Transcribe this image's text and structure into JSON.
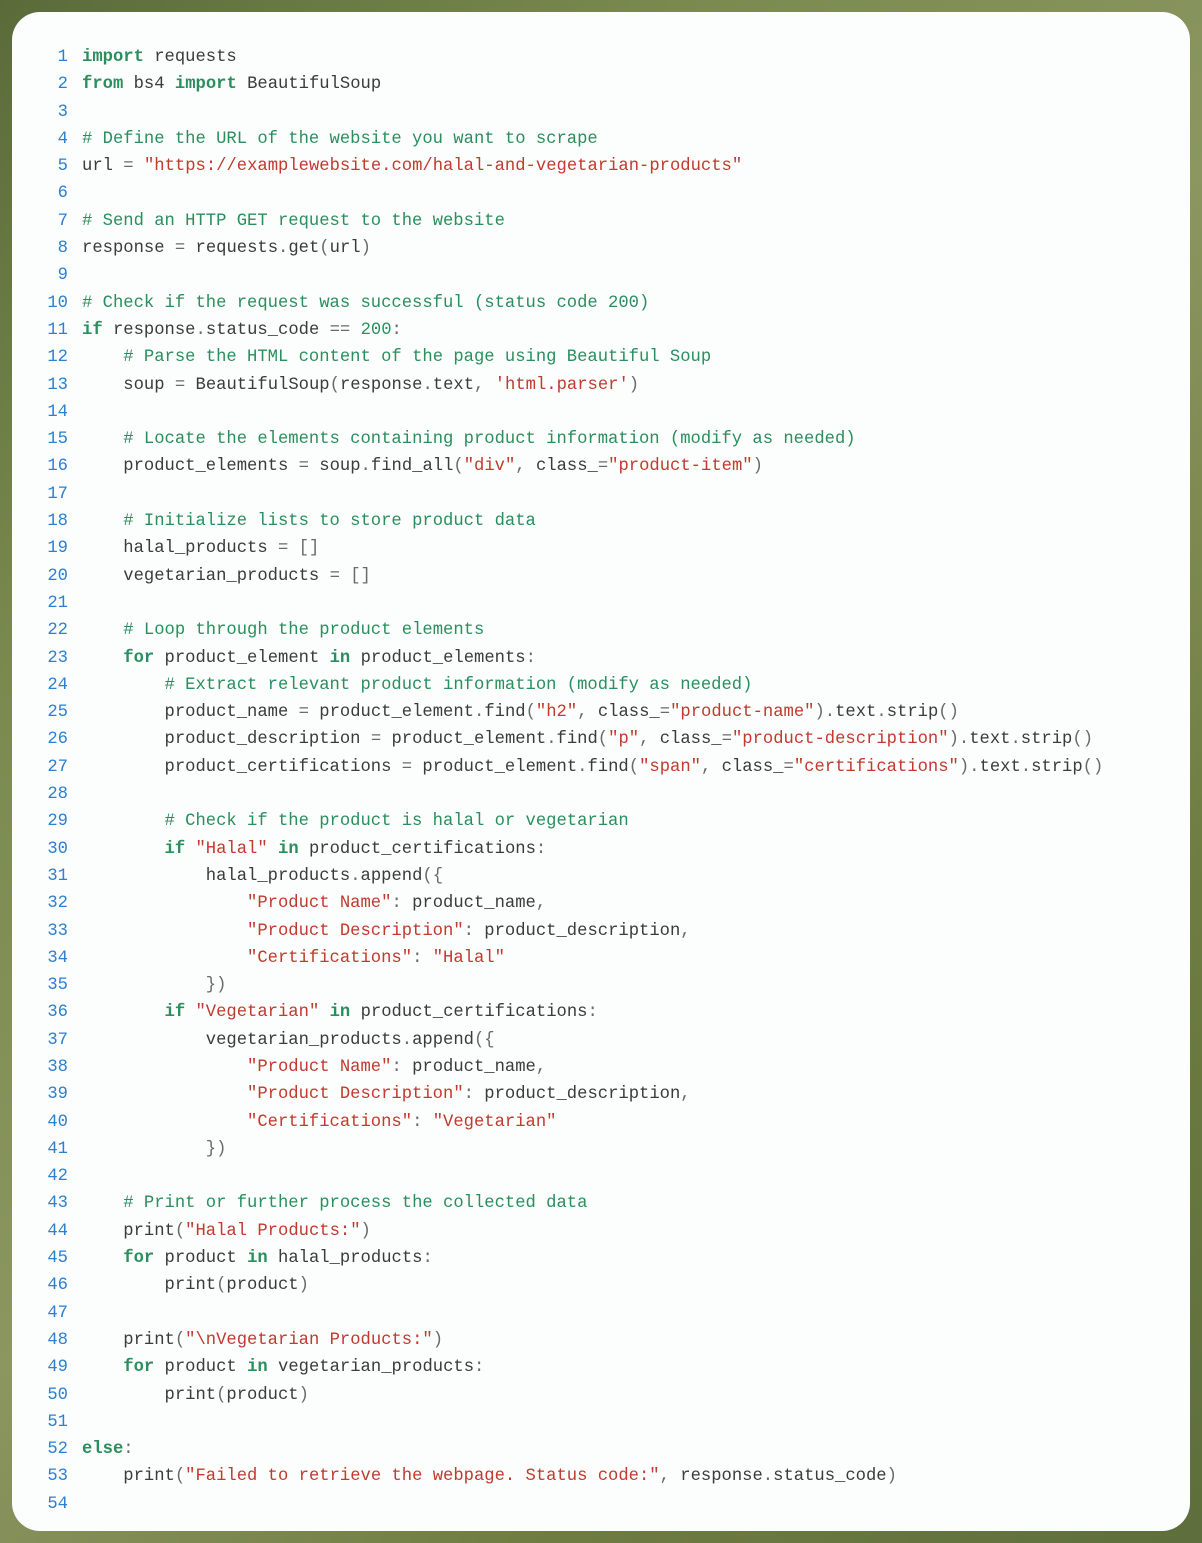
{
  "lines": [
    {
      "n": 1,
      "t": [
        [
          "kw",
          "import"
        ],
        [
          "sp",
          " "
        ],
        [
          "id",
          "requests"
        ]
      ]
    },
    {
      "n": 2,
      "t": [
        [
          "kw",
          "from"
        ],
        [
          "sp",
          " "
        ],
        [
          "id",
          "bs4"
        ],
        [
          "sp",
          " "
        ],
        [
          "kw",
          "import"
        ],
        [
          "sp",
          " "
        ],
        [
          "id",
          "BeautifulSoup"
        ]
      ]
    },
    {
      "n": 3,
      "t": []
    },
    {
      "n": 4,
      "t": [
        [
          "cm",
          "# Define the URL of the website you want to scrape"
        ]
      ]
    },
    {
      "n": 5,
      "t": [
        [
          "id",
          "url"
        ],
        [
          "sp",
          " "
        ],
        [
          "op",
          "="
        ],
        [
          "sp",
          " "
        ],
        [
          "str",
          "\"https://examplewebsite.com/halal-and-vegetarian-products\""
        ]
      ]
    },
    {
      "n": 6,
      "t": []
    },
    {
      "n": 7,
      "t": [
        [
          "cm",
          "# Send an HTTP GET request to the website"
        ]
      ]
    },
    {
      "n": 8,
      "t": [
        [
          "id",
          "response"
        ],
        [
          "sp",
          " "
        ],
        [
          "op",
          "="
        ],
        [
          "sp",
          " "
        ],
        [
          "id",
          "requests"
        ],
        [
          "op",
          "."
        ],
        [
          "id",
          "get"
        ],
        [
          "op",
          "("
        ],
        [
          "id",
          "url"
        ],
        [
          "op",
          ")"
        ]
      ]
    },
    {
      "n": 9,
      "t": []
    },
    {
      "n": 10,
      "t": [
        [
          "cm",
          "# Check if the request was successful (status code 200)"
        ]
      ]
    },
    {
      "n": 11,
      "t": [
        [
          "kw",
          "if"
        ],
        [
          "sp",
          " "
        ],
        [
          "id",
          "response"
        ],
        [
          "op",
          "."
        ],
        [
          "id",
          "status_code"
        ],
        [
          "sp",
          " "
        ],
        [
          "op",
          "=="
        ],
        [
          "sp",
          " "
        ],
        [
          "num",
          "200"
        ],
        [
          "op",
          ":"
        ]
      ]
    },
    {
      "n": 12,
      "t": [
        [
          "sp",
          "    "
        ],
        [
          "cm",
          "# Parse the HTML content of the page using Beautiful Soup"
        ]
      ]
    },
    {
      "n": 13,
      "t": [
        [
          "sp",
          "    "
        ],
        [
          "id",
          "soup"
        ],
        [
          "sp",
          " "
        ],
        [
          "op",
          "="
        ],
        [
          "sp",
          " "
        ],
        [
          "id",
          "BeautifulSoup"
        ],
        [
          "op",
          "("
        ],
        [
          "id",
          "response"
        ],
        [
          "op",
          "."
        ],
        [
          "id",
          "text"
        ],
        [
          "op",
          ","
        ],
        [
          "sp",
          " "
        ],
        [
          "str",
          "'html.parser'"
        ],
        [
          "op",
          ")"
        ]
      ]
    },
    {
      "n": 14,
      "t": []
    },
    {
      "n": 15,
      "t": [
        [
          "sp",
          "    "
        ],
        [
          "cm",
          "# Locate the elements containing product information (modify as needed)"
        ]
      ]
    },
    {
      "n": 16,
      "t": [
        [
          "sp",
          "    "
        ],
        [
          "id",
          "product_elements"
        ],
        [
          "sp",
          " "
        ],
        [
          "op",
          "="
        ],
        [
          "sp",
          " "
        ],
        [
          "id",
          "soup"
        ],
        [
          "op",
          "."
        ],
        [
          "id",
          "find_all"
        ],
        [
          "op",
          "("
        ],
        [
          "str",
          "\"div\""
        ],
        [
          "op",
          ","
        ],
        [
          "sp",
          " "
        ],
        [
          "id",
          "class_"
        ],
        [
          "op",
          "="
        ],
        [
          "str",
          "\"product-item\""
        ],
        [
          "op",
          ")"
        ]
      ]
    },
    {
      "n": 17,
      "t": []
    },
    {
      "n": 18,
      "t": [
        [
          "sp",
          "    "
        ],
        [
          "cm",
          "# Initialize lists to store product data"
        ]
      ]
    },
    {
      "n": 19,
      "t": [
        [
          "sp",
          "    "
        ],
        [
          "id",
          "halal_products"
        ],
        [
          "sp",
          " "
        ],
        [
          "op",
          "="
        ],
        [
          "sp",
          " "
        ],
        [
          "op",
          "[]"
        ]
      ]
    },
    {
      "n": 20,
      "t": [
        [
          "sp",
          "    "
        ],
        [
          "id",
          "vegetarian_products"
        ],
        [
          "sp",
          " "
        ],
        [
          "op",
          "="
        ],
        [
          "sp",
          " "
        ],
        [
          "op",
          "[]"
        ]
      ]
    },
    {
      "n": 21,
      "t": []
    },
    {
      "n": 22,
      "t": [
        [
          "sp",
          "    "
        ],
        [
          "cm",
          "# Loop through the product elements"
        ]
      ]
    },
    {
      "n": 23,
      "t": [
        [
          "sp",
          "    "
        ],
        [
          "kw",
          "for"
        ],
        [
          "sp",
          " "
        ],
        [
          "id",
          "product_element"
        ],
        [
          "sp",
          " "
        ],
        [
          "kw",
          "in"
        ],
        [
          "sp",
          " "
        ],
        [
          "id",
          "product_elements"
        ],
        [
          "op",
          ":"
        ]
      ]
    },
    {
      "n": 24,
      "t": [
        [
          "sp",
          "        "
        ],
        [
          "cm",
          "# Extract relevant product information (modify as needed)"
        ]
      ]
    },
    {
      "n": 25,
      "t": [
        [
          "sp",
          "        "
        ],
        [
          "id",
          "product_name"
        ],
        [
          "sp",
          " "
        ],
        [
          "op",
          "="
        ],
        [
          "sp",
          " "
        ],
        [
          "id",
          "product_element"
        ],
        [
          "op",
          "."
        ],
        [
          "id",
          "find"
        ],
        [
          "op",
          "("
        ],
        [
          "str",
          "\"h2\""
        ],
        [
          "op",
          ","
        ],
        [
          "sp",
          " "
        ],
        [
          "id",
          "class_"
        ],
        [
          "op",
          "="
        ],
        [
          "str",
          "\"product-name\""
        ],
        [
          "op",
          ")."
        ],
        [
          "id",
          "text"
        ],
        [
          "op",
          "."
        ],
        [
          "id",
          "strip"
        ],
        [
          "op",
          "()"
        ]
      ]
    },
    {
      "n": 26,
      "t": [
        [
          "sp",
          "        "
        ],
        [
          "id",
          "product_description"
        ],
        [
          "sp",
          " "
        ],
        [
          "op",
          "="
        ],
        [
          "sp",
          " "
        ],
        [
          "id",
          "product_element"
        ],
        [
          "op",
          "."
        ],
        [
          "id",
          "find"
        ],
        [
          "op",
          "("
        ],
        [
          "str",
          "\"p\""
        ],
        [
          "op",
          ","
        ],
        [
          "sp",
          " "
        ],
        [
          "id",
          "class_"
        ],
        [
          "op",
          "="
        ],
        [
          "str",
          "\"product-description\""
        ],
        [
          "op",
          ")."
        ],
        [
          "id",
          "text"
        ],
        [
          "op",
          "."
        ],
        [
          "id",
          "strip"
        ],
        [
          "op",
          "()"
        ]
      ]
    },
    {
      "n": 27,
      "t": [
        [
          "sp",
          "        "
        ],
        [
          "id",
          "product_certifications"
        ],
        [
          "sp",
          " "
        ],
        [
          "op",
          "="
        ],
        [
          "sp",
          " "
        ],
        [
          "id",
          "product_element"
        ],
        [
          "op",
          "."
        ],
        [
          "id",
          "find"
        ],
        [
          "op",
          "("
        ],
        [
          "str",
          "\"span\""
        ],
        [
          "op",
          ","
        ],
        [
          "sp",
          " "
        ],
        [
          "id",
          "class_"
        ],
        [
          "op",
          "="
        ],
        [
          "str",
          "\"certifications\""
        ],
        [
          "op",
          ")."
        ],
        [
          "id",
          "text"
        ],
        [
          "op",
          "."
        ],
        [
          "id",
          "strip"
        ],
        [
          "op",
          "()"
        ]
      ]
    },
    {
      "n": 28,
      "t": []
    },
    {
      "n": 29,
      "t": [
        [
          "sp",
          "        "
        ],
        [
          "cm",
          "# Check if the product is halal or vegetarian"
        ]
      ]
    },
    {
      "n": 30,
      "t": [
        [
          "sp",
          "        "
        ],
        [
          "kw",
          "if"
        ],
        [
          "sp",
          " "
        ],
        [
          "str",
          "\"Halal\""
        ],
        [
          "sp",
          " "
        ],
        [
          "kw",
          "in"
        ],
        [
          "sp",
          " "
        ],
        [
          "id",
          "product_certifications"
        ],
        [
          "op",
          ":"
        ]
      ]
    },
    {
      "n": 31,
      "t": [
        [
          "sp",
          "            "
        ],
        [
          "id",
          "halal_products"
        ],
        [
          "op",
          "."
        ],
        [
          "id",
          "append"
        ],
        [
          "op",
          "({"
        ]
      ]
    },
    {
      "n": 32,
      "t": [
        [
          "sp",
          "                "
        ],
        [
          "str",
          "\"Product Name\""
        ],
        [
          "op",
          ":"
        ],
        [
          "sp",
          " "
        ],
        [
          "id",
          "product_name"
        ],
        [
          "op",
          ","
        ]
      ]
    },
    {
      "n": 33,
      "t": [
        [
          "sp",
          "                "
        ],
        [
          "str",
          "\"Product Description\""
        ],
        [
          "op",
          ":"
        ],
        [
          "sp",
          " "
        ],
        [
          "id",
          "product_description"
        ],
        [
          "op",
          ","
        ]
      ]
    },
    {
      "n": 34,
      "t": [
        [
          "sp",
          "                "
        ],
        [
          "str",
          "\"Certifications\""
        ],
        [
          "op",
          ":"
        ],
        [
          "sp",
          " "
        ],
        [
          "str",
          "\"Halal\""
        ]
      ]
    },
    {
      "n": 35,
      "t": [
        [
          "sp",
          "            "
        ],
        [
          "op",
          "})"
        ]
      ]
    },
    {
      "n": 36,
      "t": [
        [
          "sp",
          "        "
        ],
        [
          "kw",
          "if"
        ],
        [
          "sp",
          " "
        ],
        [
          "str",
          "\"Vegetarian\""
        ],
        [
          "sp",
          " "
        ],
        [
          "kw",
          "in"
        ],
        [
          "sp",
          " "
        ],
        [
          "id",
          "product_certifications"
        ],
        [
          "op",
          ":"
        ]
      ]
    },
    {
      "n": 37,
      "t": [
        [
          "sp",
          "            "
        ],
        [
          "id",
          "vegetarian_products"
        ],
        [
          "op",
          "."
        ],
        [
          "id",
          "append"
        ],
        [
          "op",
          "({"
        ]
      ]
    },
    {
      "n": 38,
      "t": [
        [
          "sp",
          "                "
        ],
        [
          "str",
          "\"Product Name\""
        ],
        [
          "op",
          ":"
        ],
        [
          "sp",
          " "
        ],
        [
          "id",
          "product_name"
        ],
        [
          "op",
          ","
        ]
      ]
    },
    {
      "n": 39,
      "t": [
        [
          "sp",
          "                "
        ],
        [
          "str",
          "\"Product Description\""
        ],
        [
          "op",
          ":"
        ],
        [
          "sp",
          " "
        ],
        [
          "id",
          "product_description"
        ],
        [
          "op",
          ","
        ]
      ]
    },
    {
      "n": 40,
      "t": [
        [
          "sp",
          "                "
        ],
        [
          "str",
          "\"Certifications\""
        ],
        [
          "op",
          ":"
        ],
        [
          "sp",
          " "
        ],
        [
          "str",
          "\"Vegetarian\""
        ]
      ]
    },
    {
      "n": 41,
      "t": [
        [
          "sp",
          "            "
        ],
        [
          "op",
          "})"
        ]
      ]
    },
    {
      "n": 42,
      "t": []
    },
    {
      "n": 43,
      "t": [
        [
          "sp",
          "    "
        ],
        [
          "cm",
          "# Print or further process the collected data"
        ]
      ]
    },
    {
      "n": 44,
      "t": [
        [
          "sp",
          "    "
        ],
        [
          "fn",
          "print"
        ],
        [
          "op",
          "("
        ],
        [
          "str",
          "\"Halal Products:\""
        ],
        [
          "op",
          ")"
        ]
      ]
    },
    {
      "n": 45,
      "t": [
        [
          "sp",
          "    "
        ],
        [
          "kw",
          "for"
        ],
        [
          "sp",
          " "
        ],
        [
          "id",
          "product"
        ],
        [
          "sp",
          " "
        ],
        [
          "kw",
          "in"
        ],
        [
          "sp",
          " "
        ],
        [
          "id",
          "halal_products"
        ],
        [
          "op",
          ":"
        ]
      ]
    },
    {
      "n": 46,
      "t": [
        [
          "sp",
          "        "
        ],
        [
          "fn",
          "print"
        ],
        [
          "op",
          "("
        ],
        [
          "id",
          "product"
        ],
        [
          "op",
          ")"
        ]
      ]
    },
    {
      "n": 47,
      "t": []
    },
    {
      "n": 48,
      "t": [
        [
          "sp",
          "    "
        ],
        [
          "fn",
          "print"
        ],
        [
          "op",
          "("
        ],
        [
          "str",
          "\"\\nVegetarian Products:\""
        ],
        [
          "op",
          ")"
        ]
      ]
    },
    {
      "n": 49,
      "t": [
        [
          "sp",
          "    "
        ],
        [
          "kw",
          "for"
        ],
        [
          "sp",
          " "
        ],
        [
          "id",
          "product"
        ],
        [
          "sp",
          " "
        ],
        [
          "kw",
          "in"
        ],
        [
          "sp",
          " "
        ],
        [
          "id",
          "vegetarian_products"
        ],
        [
          "op",
          ":"
        ]
      ]
    },
    {
      "n": 50,
      "t": [
        [
          "sp",
          "        "
        ],
        [
          "fn",
          "print"
        ],
        [
          "op",
          "("
        ],
        [
          "id",
          "product"
        ],
        [
          "op",
          ")"
        ]
      ]
    },
    {
      "n": 51,
      "t": []
    },
    {
      "n": 52,
      "t": [
        [
          "kw",
          "else"
        ],
        [
          "op",
          ":"
        ]
      ]
    },
    {
      "n": 53,
      "t": [
        [
          "sp",
          "    "
        ],
        [
          "fn",
          "print"
        ],
        [
          "op",
          "("
        ],
        [
          "str",
          "\"Failed to retrieve the webpage. Status code:\""
        ],
        [
          "op",
          ","
        ],
        [
          "sp",
          " "
        ],
        [
          "id",
          "response"
        ],
        [
          "op",
          "."
        ],
        [
          "id",
          "status_code"
        ],
        [
          "op",
          ")"
        ]
      ]
    },
    {
      "n": 54,
      "t": []
    }
  ]
}
